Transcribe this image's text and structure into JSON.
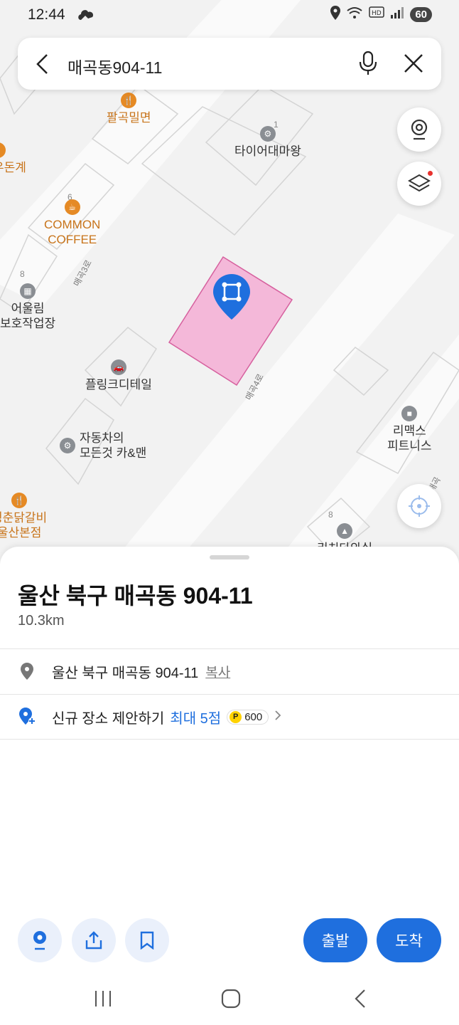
{
  "status": {
    "time": "12:44",
    "battery": "60"
  },
  "search": {
    "query": "매곡동904-11"
  },
  "map": {
    "pois": [
      {
        "name": "팔곡밀면",
        "type": "food"
      },
      {
        "name": "우돈계",
        "type": "food"
      },
      {
        "name": "COMMON",
        "type": "food"
      },
      {
        "name": "COFFEE",
        "type": "food"
      },
      {
        "name": "타이어대마왕",
        "type": "gray"
      },
      {
        "name": "어울림",
        "type": "gray"
      },
      {
        "name": "보호작업장",
        "type": "gray"
      },
      {
        "name": "플링크디테일",
        "type": "gray"
      },
      {
        "name": "자동차의",
        "type": "gray"
      },
      {
        "name": "모든것 카&맨",
        "type": "gray"
      },
      {
        "name": "리맥스",
        "type": "gray"
      },
      {
        "name": "피트니스",
        "type": "gray"
      },
      {
        "name": "청춘닭갈비",
        "type": "food"
      },
      {
        "name": "울산본점",
        "type": "food"
      },
      {
        "name": "리치다와실",
        "type": "gray"
      }
    ],
    "roads": [
      "매곡3로",
      "매곡4로",
      "매곡"
    ],
    "building_numbers": [
      "1",
      "6",
      "8",
      "8"
    ]
  },
  "sheet": {
    "title": "울산 북구 매곡동 904-11",
    "distance": "10.3km",
    "address": "울산 북구 매곡동 904-11",
    "copy_label": "복사",
    "suggest_label": "신규 장소 제안하기",
    "suggest_max": "최대 5점",
    "points_badge": "P",
    "points_value": "600",
    "depart_label": "출발",
    "arrive_label": "도착"
  },
  "colors": {
    "accent": "#1f6fde",
    "food_poi": "#c8741a",
    "parcel": "#f4b8d9"
  }
}
